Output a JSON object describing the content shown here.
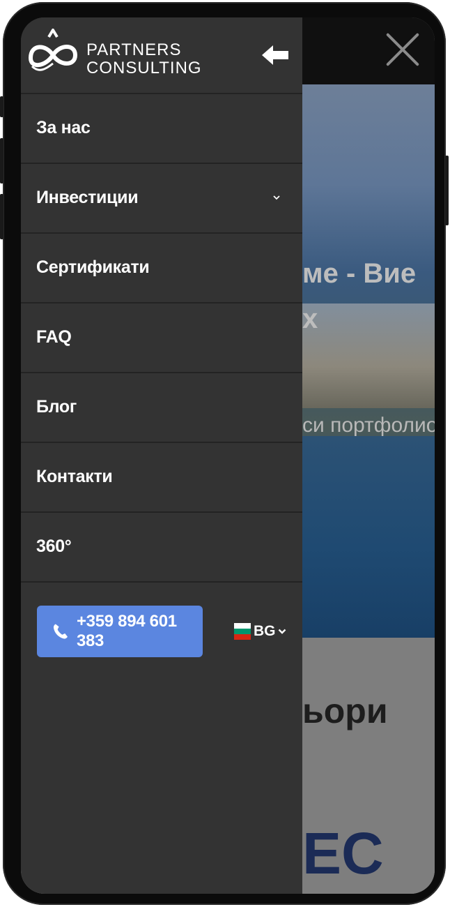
{
  "brand": {
    "line1": "PARTNERS",
    "line2": "CONSULTING"
  },
  "menu": {
    "items": [
      {
        "label": "За нас",
        "has_submenu": false
      },
      {
        "label": "Инвестиции",
        "has_submenu": true
      },
      {
        "label": "Сертификати",
        "has_submenu": false
      },
      {
        "label": "FAQ",
        "has_submenu": false
      },
      {
        "label": "Блог",
        "has_submenu": false
      },
      {
        "label": "Контакти",
        "has_submenu": false
      },
      {
        "label": "360°",
        "has_submenu": false
      }
    ]
  },
  "contact": {
    "phone": "+359 894 601 383"
  },
  "language": {
    "code": "BG",
    "flag_colors": [
      "#ffffff",
      "#00966e",
      "#d62612"
    ]
  },
  "background_page": {
    "hero_title_line1": "ме - Вие",
    "hero_title_line2": "х",
    "hero_subtitle": "си портфолио",
    "section_heading": "ьори",
    "logo_fragment": "EC"
  },
  "colors": {
    "drawer": "#333333",
    "accent": "#5b86e0",
    "divider": "#232323"
  },
  "icons": {
    "back": "arrow-left-icon",
    "close": "close-icon",
    "phone": "phone-icon",
    "dropdown": "chevron-down-icon"
  }
}
